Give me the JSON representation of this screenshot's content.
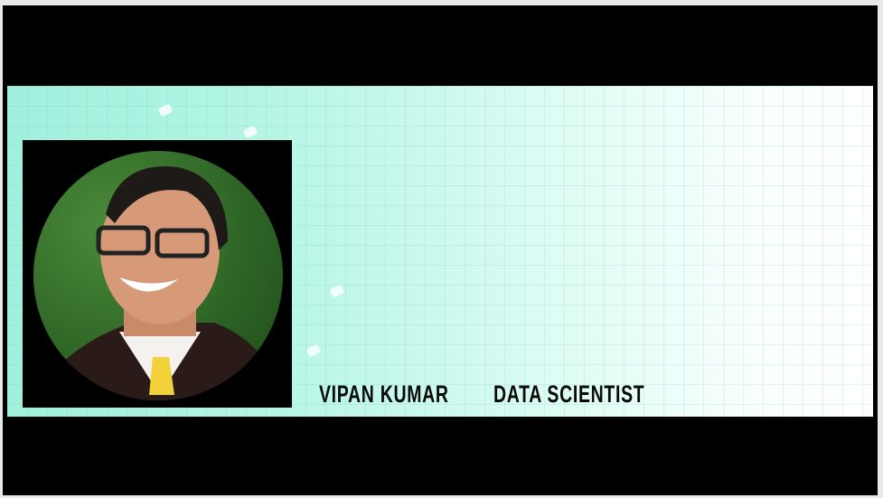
{
  "presenter": {
    "name": "VIPAN KUMAR",
    "title": "DATA SCIENTIST"
  },
  "colors": {
    "banner_accent": "#9ff0dc",
    "frame": "#000000"
  }
}
